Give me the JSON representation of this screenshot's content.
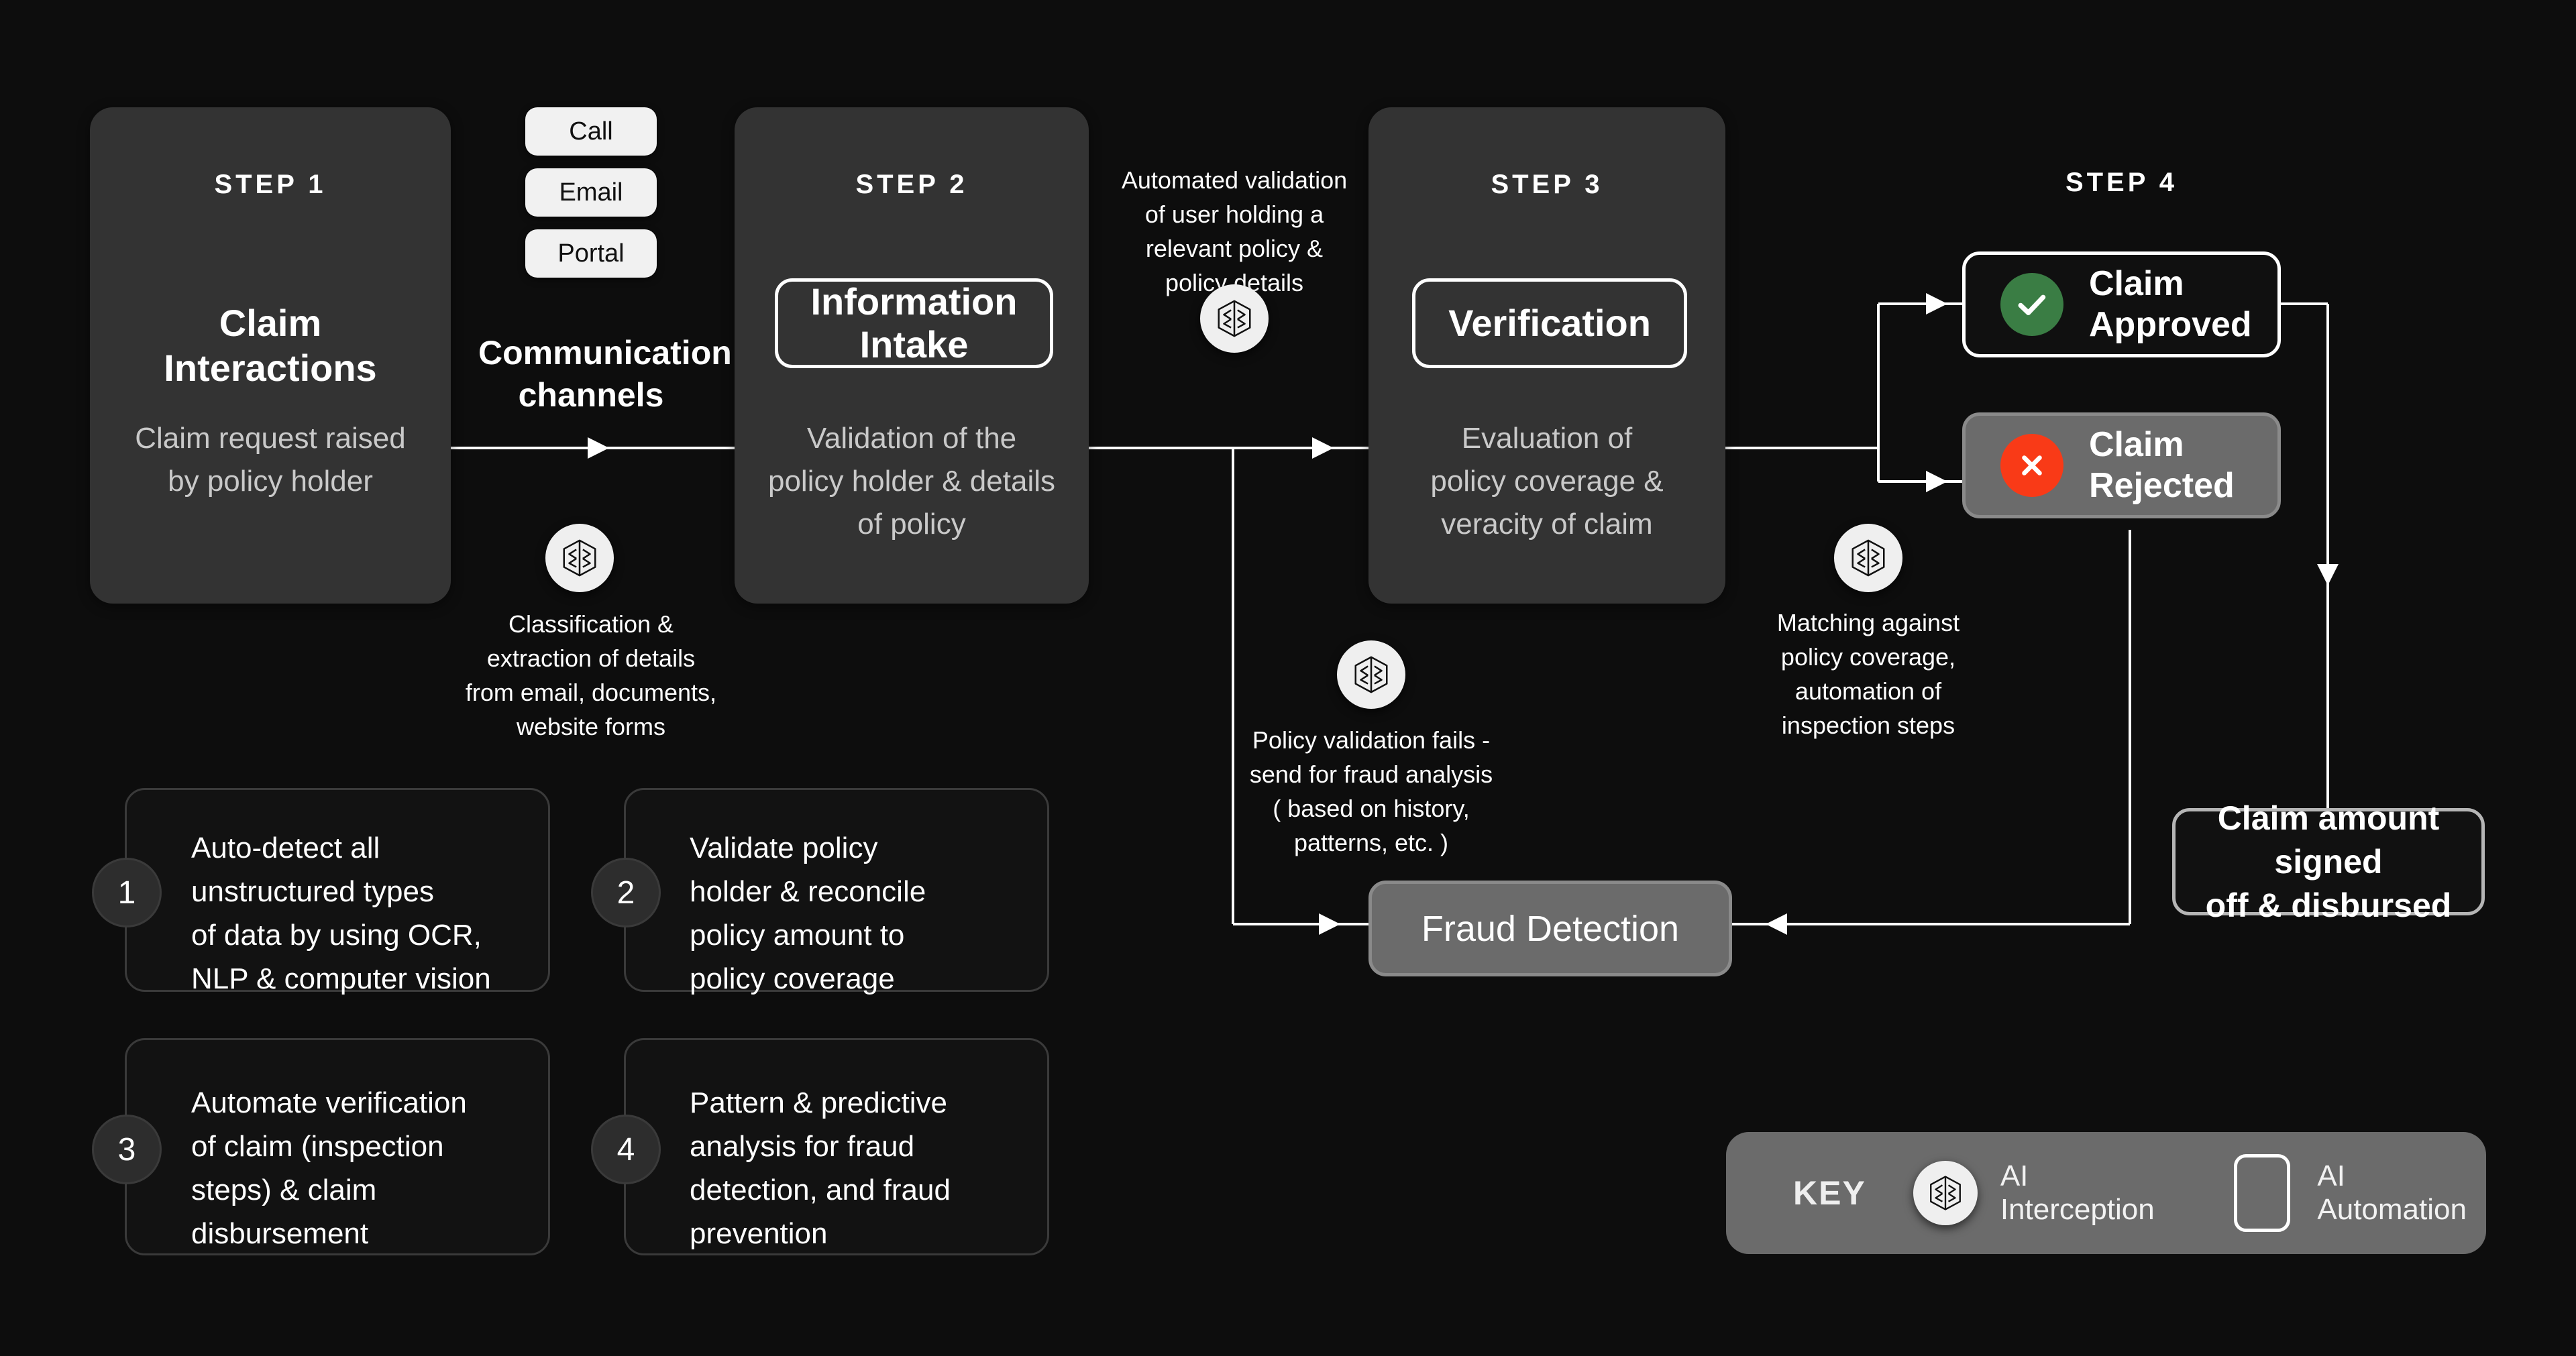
{
  "theme": {
    "background": "#0d0d0d",
    "card_bg": "#333333",
    "pill_bg": "#f1f1f1",
    "approved_color": "#3a7d44",
    "rejected_color": "#f93a17",
    "line_color": "#ffffff",
    "muted_text": "#c9c9c9"
  },
  "steps": [
    {
      "label": "STEP 1",
      "title": "Claim\nInteractions",
      "description": "Claim request raised\nby policy holder"
    },
    {
      "label": "STEP 2",
      "title": "Information\nIntake",
      "description": "Validation of the\npolicy holder & details\nof policy"
    },
    {
      "label": "STEP 3",
      "title": "Verification",
      "description": "Evaluation of\npolicy coverage &\nveracity of claim"
    },
    {
      "label": "STEP 4",
      "title": "",
      "description": ""
    }
  ],
  "step1": {
    "label": "STEP 1",
    "title_line1": "Claim",
    "title_line2": "Interactions",
    "desc_line1": "Claim request raised",
    "desc_line2": "by policy holder"
  },
  "step2": {
    "label": "STEP 2",
    "title_line1": "Information",
    "title_line2": "Intake",
    "desc_line1": "Validation of the",
    "desc_line2": "policy holder & details",
    "desc_line3": "of policy"
  },
  "step3": {
    "label": "STEP 3",
    "title": "Verification",
    "desc_line1": "Evaluation of",
    "desc_line2": "policy coverage &",
    "desc_line3": "veracity of claim"
  },
  "step4": {
    "label": "STEP 4"
  },
  "channels": {
    "title_line1": "Communication",
    "title_line2": "channels",
    "items": [
      {
        "label": "Call"
      },
      {
        "label": "Email"
      },
      {
        "label": "Portal"
      }
    ]
  },
  "notes": [
    {
      "id": "classification",
      "icon": "ai-interception-icon",
      "lines": [
        "Classification &",
        "extraction of details",
        "from email, documents,",
        "website forms"
      ]
    },
    {
      "id": "automated-validation",
      "icon": "ai-interception-icon",
      "lines": [
        "Automated validation",
        "of user holding a",
        "relevant policy &",
        "policy details"
      ]
    },
    {
      "id": "policy-validation-fails",
      "icon": "ai-interception-icon",
      "lines": [
        "Policy validation fails -",
        "send for fraud analysis",
        "( based on history,",
        "patterns, etc. )"
      ]
    },
    {
      "id": "matching-policy-coverage",
      "icon": "ai-interception-icon",
      "lines": [
        "Matching against",
        "policy coverage,",
        "automation of",
        "inspection steps"
      ]
    }
  ],
  "note_classification": {
    "l1": "Classification &",
    "l2": "extraction of details",
    "l3": "from email, documents,",
    "l4": "website forms"
  },
  "note_automated": {
    "l1": "Automated validation",
    "l2": "of user holding a",
    "l3": "relevant policy &",
    "l4": "policy details"
  },
  "note_fraud": {
    "l1": "Policy validation fails -",
    "l2": "send for fraud analysis",
    "l3": "( based on history,",
    "l4": "patterns, etc. )"
  },
  "note_matching": {
    "l1": "Matching against",
    "l2": "policy coverage,",
    "l3": "automation of",
    "l4": "inspection steps"
  },
  "outcomes": {
    "approved": {
      "icon": "check-circle-icon",
      "line1": "Claim",
      "line2": "Approved"
    },
    "rejected": {
      "icon": "x-circle-icon",
      "line1": "Claim",
      "line2": "Rejected"
    }
  },
  "fraud_detection": {
    "label": "Fraud Detection"
  },
  "disbursement": {
    "line1": "Claim amount signed",
    "line2": "off & disbursed"
  },
  "features": [
    {
      "number": "1",
      "lines": [
        "Auto-detect all",
        "unstructured types",
        "of data by using OCR,",
        "NLP & computer vision"
      ]
    },
    {
      "number": "2",
      "lines": [
        "Validate policy",
        "holder & reconcile",
        "policy amount to",
        "policy coverage"
      ]
    },
    {
      "number": "3",
      "lines": [
        "Automate verification",
        "of claim (inspection",
        "steps) & claim",
        "disbursement"
      ]
    },
    {
      "number": "4",
      "lines": [
        "Pattern & predictive",
        "analysis for fraud",
        "detection, and fraud",
        "prevention"
      ]
    }
  ],
  "feature1": {
    "n": "1",
    "l1": "Auto-detect all",
    "l2": "unstructured types",
    "l3": "of data by using OCR,",
    "l4": "NLP & computer vision"
  },
  "feature2": {
    "n": "2",
    "l1": "Validate policy",
    "l2": "holder & reconcile",
    "l3": "policy amount to",
    "l4": "policy coverage"
  },
  "feature3": {
    "n": "3",
    "l1": "Automate verification",
    "l2": "of claim (inspection",
    "l3": "steps) & claim",
    "l4": "disbursement"
  },
  "feature4": {
    "n": "4",
    "l1": "Pattern & predictive",
    "l2": "analysis for fraud",
    "l3": "detection, and fraud",
    "l4": "prevention"
  },
  "key": {
    "word": "KEY",
    "interception_label": "AI Interception",
    "automation_label": "AI Automation",
    "interception_icon": "ai-interception-icon",
    "automation_icon": "ai-automation-outline-icon"
  }
}
